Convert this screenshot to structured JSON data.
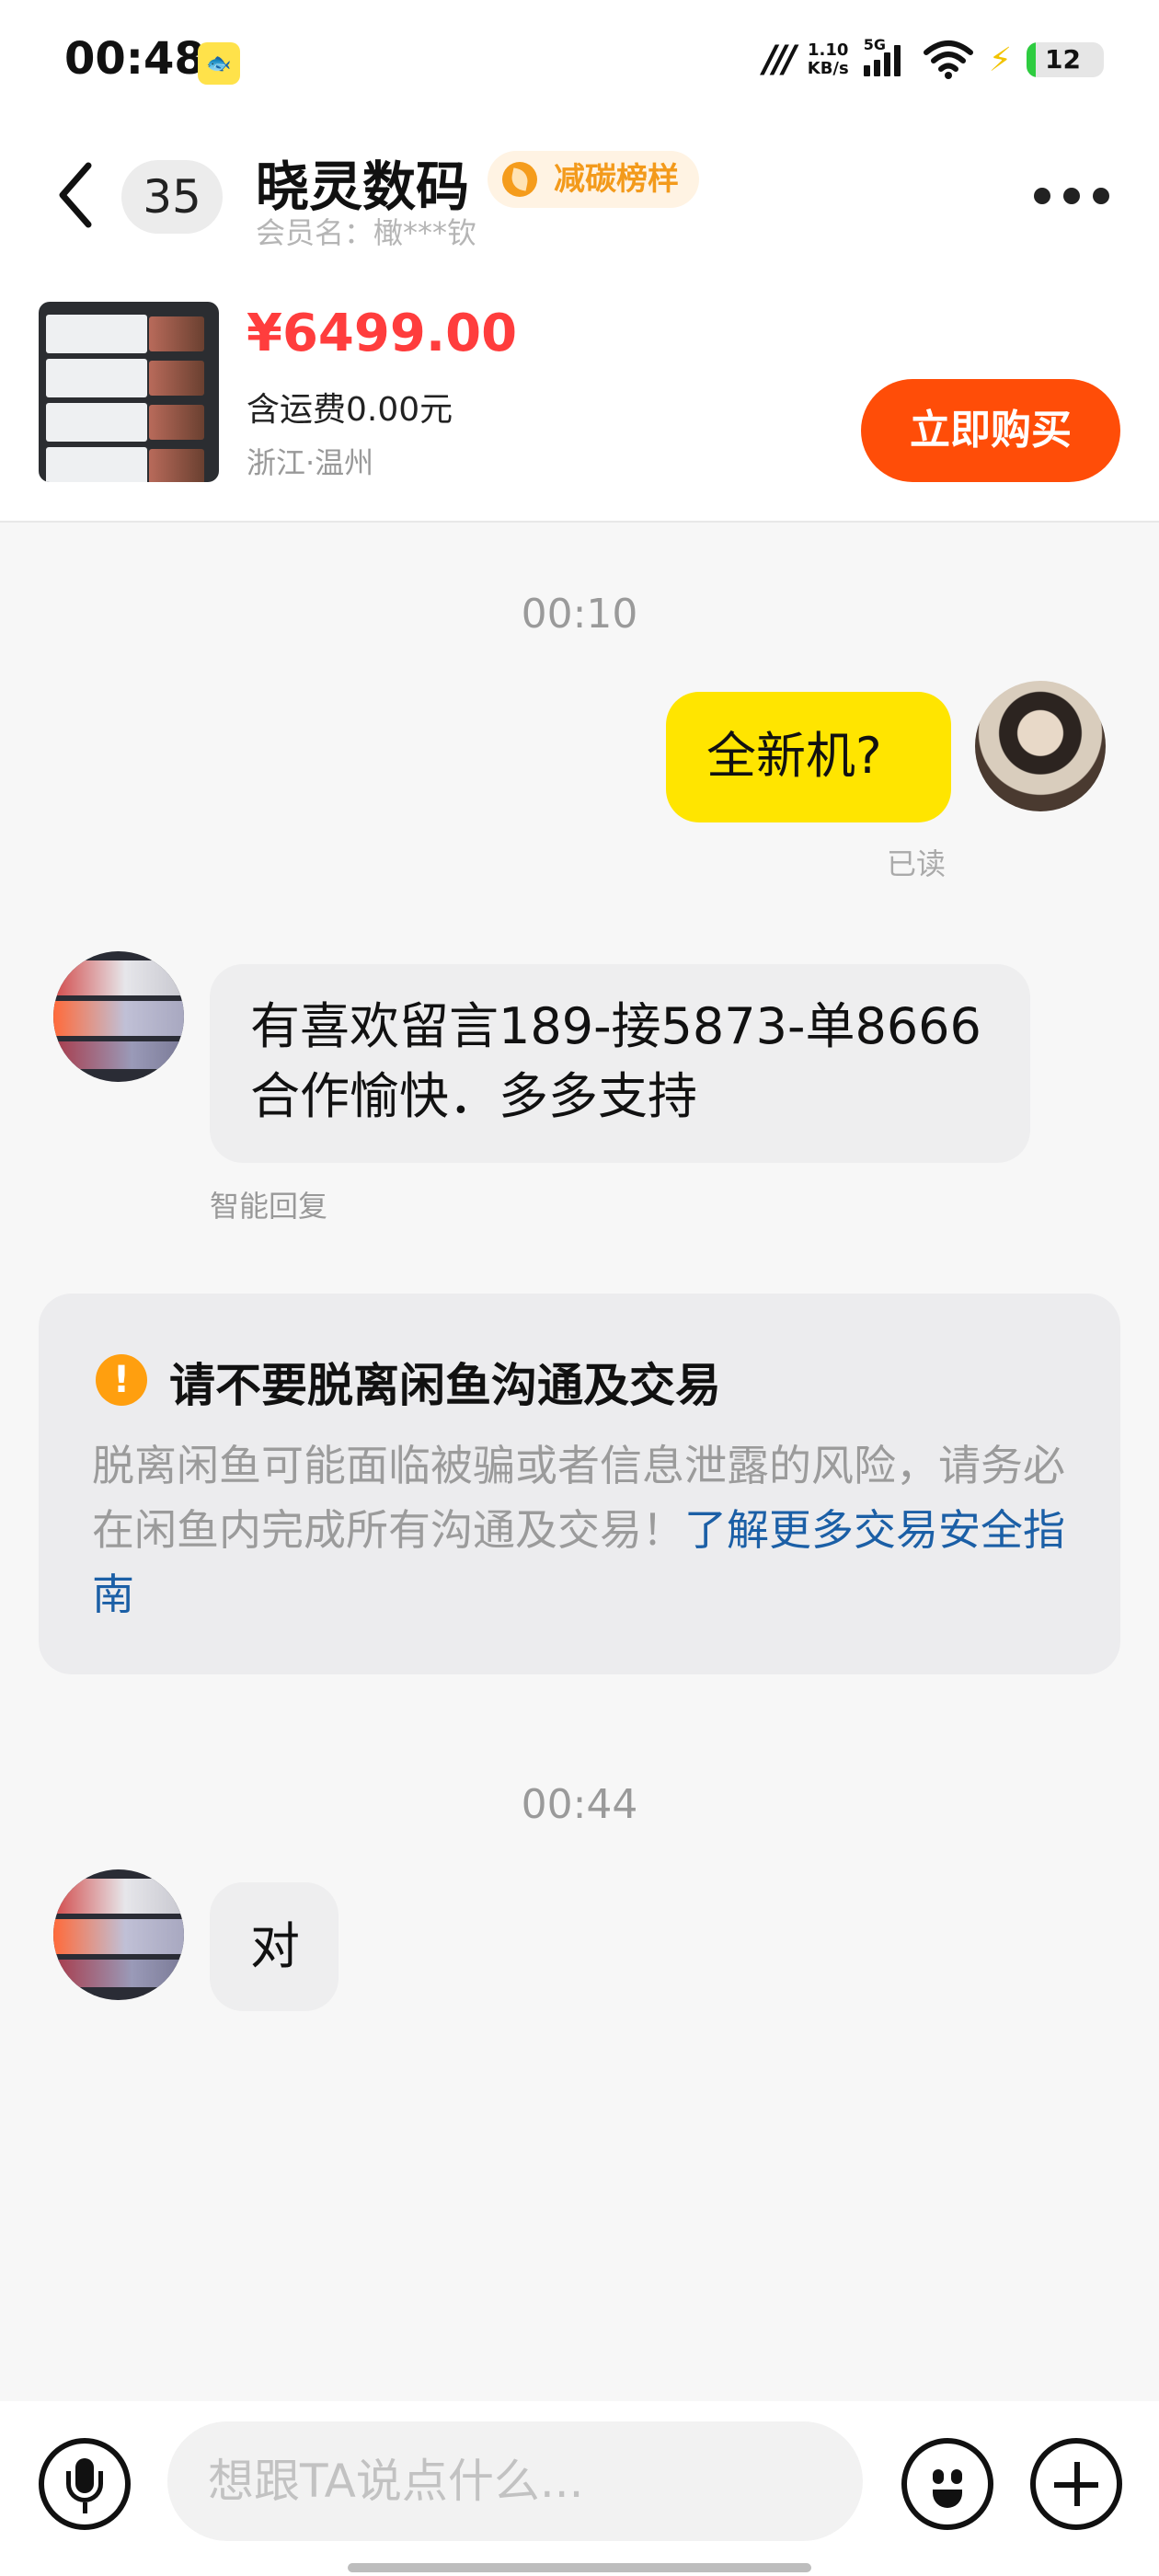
{
  "status_bar": {
    "time": "00:48",
    "network_speed_value": "1.10",
    "network_speed_unit": "KB/s",
    "signal_label": "5G",
    "battery_percent": "12",
    "battery_level": 0.12,
    "icons": [
      "app-notification-icon",
      "network-icon",
      "signal-icon",
      "wifi-icon",
      "charging-icon",
      "battery-icon"
    ]
  },
  "header": {
    "unread_count": "35",
    "shop_name": "晓灵数码",
    "shop_tag": "减碳榜样",
    "member_label": "会员名：",
    "member_name": "橄***钦",
    "icons": [
      "back-icon",
      "more-icon"
    ]
  },
  "product": {
    "price": "¥6499.00",
    "shipping": "含运费0.00元",
    "location": "浙江·温州",
    "buy_button": "立即购买"
  },
  "chat": {
    "timestamp_1": "00:10",
    "msg_me_1": "全新机?",
    "read_status": "已读",
    "msg_shop_1_line1": "有喜欢留言189-接5873-单8666",
    "msg_shop_1_line2": "合作愉快．多多支持",
    "smart_reply_label": "智能回复",
    "warning_title": "请不要脱离闲鱼沟通及交易",
    "warning_body": "脱离闲鱼可能面临被骗或者信息泄露的风险，请务必在闲鱼内完成所有沟通及交易！",
    "warning_link": "了解更多交易安全指南",
    "timestamp_2": "00:44",
    "msg_shop_2": "对"
  },
  "input_bar": {
    "placeholder": "想跟TA说点什么...",
    "icons": [
      "mic-icon",
      "emoji-icon",
      "plus-icon"
    ]
  },
  "colors": {
    "accent_yellow": "#ffe500",
    "price_red": "#ff3d3d",
    "buy_orange": "#ff4d08",
    "link_blue": "#1b5fa6",
    "warning_orange": "#ff9f0f"
  }
}
